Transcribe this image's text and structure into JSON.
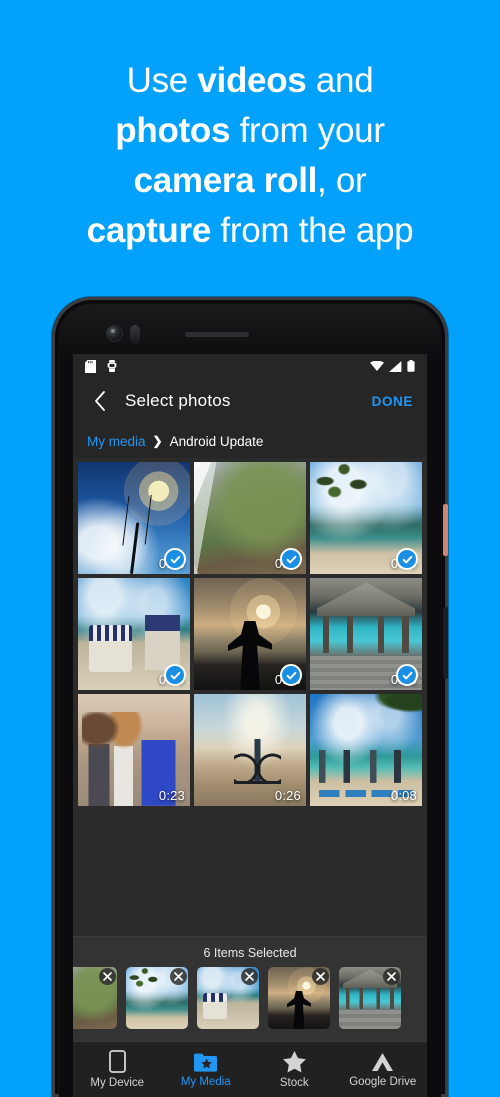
{
  "theme": {
    "background_blue": "#02a1fb",
    "accent_blue": "#2196f3",
    "check_blue": "#1a8fe3",
    "screen_bg": "#2b2b2b",
    "bar_bg": "#262626"
  },
  "headline": {
    "line1_a": "Use ",
    "line1_b": "videos",
    "line1_c": " and",
    "line2_a": "photos",
    "line2_b": " from your",
    "line3_a": "camera roll",
    "line3_b": ", or",
    "line4_a": "capture",
    "line4_b": " from the app"
  },
  "phone": {
    "status_bar": {
      "left_icons": [
        "sd-card-icon",
        "android-robot-icon"
      ],
      "right_icons": [
        "wifi-icon",
        "cell-signal-icon",
        "battery-icon"
      ]
    },
    "app_bar": {
      "back_icon": "chevron-left-icon",
      "title": "Select photos",
      "done_label": "DONE"
    },
    "breadcrumb": {
      "root_label": "My media",
      "separator": "›",
      "current_label": "Android Update"
    },
    "grid": {
      "items": [
        {
          "art": "art-sunset-palm",
          "duration": "0:20",
          "selected": true,
          "alt": "sunset over ocean with palm tree"
        },
        {
          "art": "art-coast",
          "duration": "0:27",
          "selected": true,
          "alt": "aerial view of green coastline and surf"
        },
        {
          "art": "art-palm-beach",
          "duration": "0:19",
          "selected": true,
          "alt": "palm tree over tropical beach"
        },
        {
          "art": "art-chairs",
          "duration": "0:09",
          "selected": true,
          "alt": "beach chairs with straw hat"
        },
        {
          "art": "art-silhouette",
          "duration": "0:13",
          "selected": true,
          "alt": "woman silhouette arms outstretched at sunset"
        },
        {
          "art": "art-hut",
          "duration": "0:25",
          "selected": true,
          "alt": "thatched hut over turquoise water"
        },
        {
          "art": "art-friends",
          "duration": "0:23",
          "selected": false,
          "alt": "friends hugging on the beach"
        },
        {
          "art": "art-bike",
          "duration": "0:26",
          "selected": false,
          "alt": "couple riding a bicycle on the beach"
        },
        {
          "art": "art-yoga",
          "duration": "0:08",
          "selected": false,
          "alt": "group doing yoga on the beach"
        }
      ]
    },
    "tray": {
      "count_label": "6 Items Selected",
      "remove_icon": "close-icon",
      "thumbs": [
        {
          "art": "art-coast",
          "alt": "aerial coastline"
        },
        {
          "art": "art-palm-beach",
          "alt": "palm tree beach"
        },
        {
          "art": "art-chairs",
          "alt": "beach chairs"
        },
        {
          "art": "art-silhouette",
          "alt": "sunset silhouette"
        },
        {
          "art": "art-hut",
          "alt": "thatched hut"
        }
      ]
    },
    "bottom_nav": {
      "items": [
        {
          "label": "My Device",
          "icon": "phone-icon",
          "active": false
        },
        {
          "label": "My Media",
          "icon": "folder-star-icon",
          "active": true
        },
        {
          "label": "Stock",
          "icon": "star-icon",
          "active": false
        },
        {
          "label": "Google Drive",
          "icon": "google-drive-icon",
          "active": false
        }
      ]
    }
  }
}
